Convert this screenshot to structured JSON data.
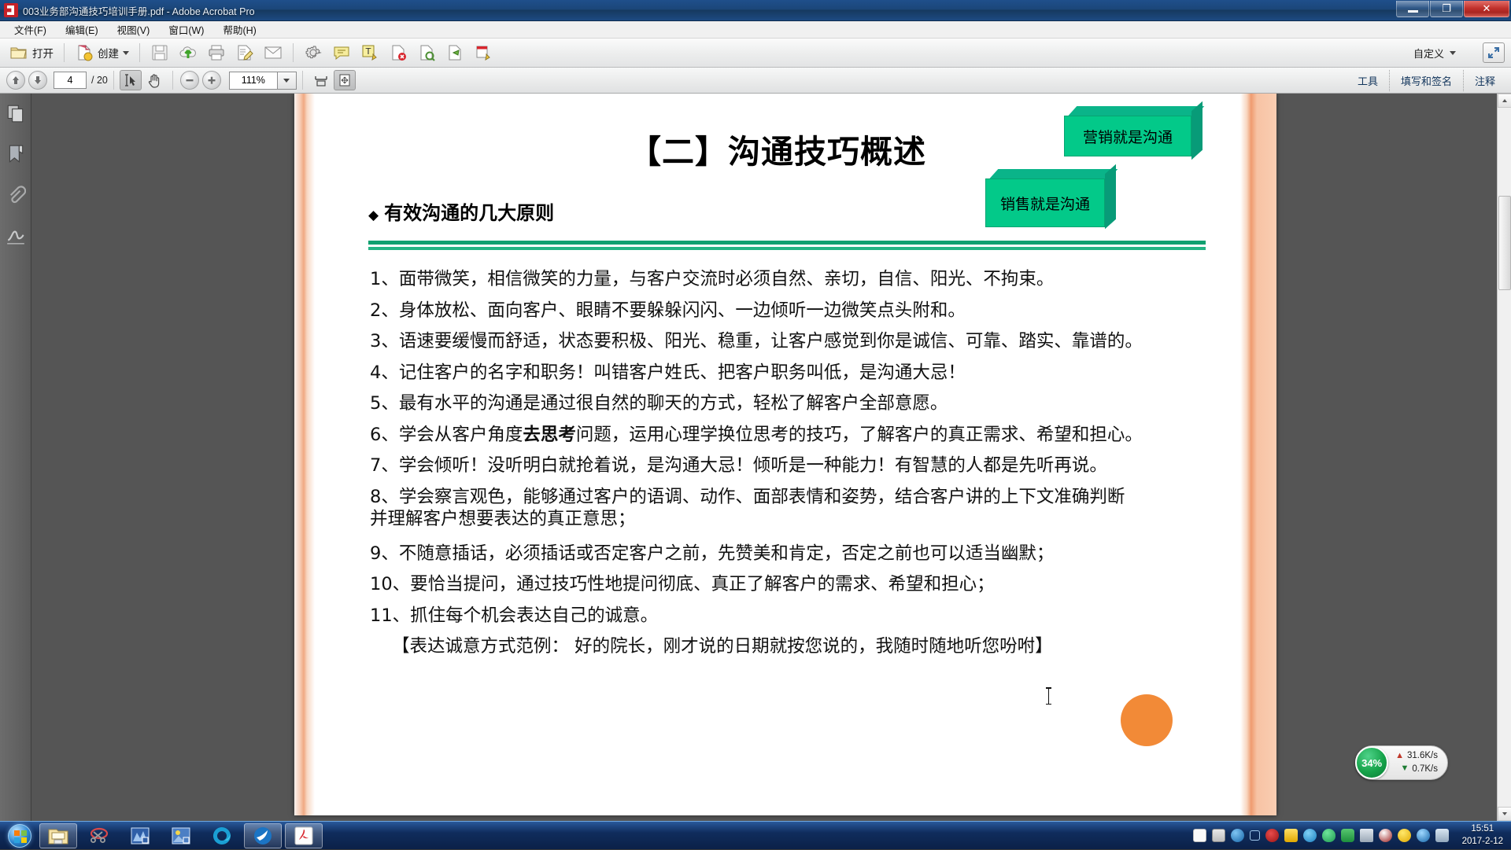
{
  "window": {
    "title": "003业务部沟通技巧培训手册.pdf - Adobe Acrobat Pro",
    "app_icon": "acrobat-icon",
    "minimize_label": "",
    "restore_label": "❐",
    "close_label": "✕"
  },
  "menubar": {
    "items": [
      {
        "label": "文件(F)",
        "name": "menu-file"
      },
      {
        "label": "编辑(E)",
        "name": "menu-edit"
      },
      {
        "label": "视图(V)",
        "name": "menu-view"
      },
      {
        "label": "窗口(W)",
        "name": "menu-window"
      },
      {
        "label": "帮助(H)",
        "name": "menu-help"
      }
    ]
  },
  "toolbar_main": {
    "open_label": "打开",
    "create_label": "创建",
    "customize_label": "自定义",
    "icons": [
      "open-folder-icon",
      "create-pdf-icon",
      "save-icon",
      "upload-cloud-icon",
      "print-icon",
      "edit-document-icon",
      "email-icon",
      "settings-gear-icon",
      "comment-bubble-icon",
      "text-edit-icon",
      "delete-page-icon",
      "redact-icon",
      "stamp-icon",
      "sign-edit-icon",
      "expand-toolbar-icon"
    ]
  },
  "toolbar_nav": {
    "page_current": "4",
    "page_total": "/ 20",
    "zoom_value": "111%",
    "icons": [
      "page-up-icon",
      "page-down-icon",
      "select-tool-icon",
      "hand-tool-icon",
      "zoom-out-icon",
      "zoom-in-icon",
      "zoom-dropdown-icon",
      "fit-width-icon",
      "fit-page-icon"
    ],
    "right_tabs": [
      {
        "label": "工具",
        "name": "tab-tools"
      },
      {
        "label": "填写和签名",
        "name": "tab-fill-sign"
      },
      {
        "label": "注释",
        "name": "tab-comment"
      }
    ]
  },
  "left_rail": {
    "items": [
      {
        "name": "page-thumbnails-icon"
      },
      {
        "name": "bookmarks-icon"
      },
      {
        "name": "attachments-icon"
      },
      {
        "name": "signatures-icon"
      }
    ]
  },
  "slide": {
    "title": "【二】沟通技巧概述",
    "bullet_marker": "◆",
    "subtitle": "有效沟通的几大原则",
    "badge_marketing": "营销就是沟通",
    "badge_sales": "销售就是沟通",
    "accent_green": "#03c989",
    "rule_green": "#10a070",
    "orange_dot": "#f28a37",
    "items": [
      "1、面带微笑，相信微笑的力量，与客户交流时必须自然、亲切，自信、阳光、不拘束。",
      "2、身体放松、面向客户、眼睛不要躲躲闪闪、一边倾听一边微笑点头附和。",
      "3、语速要缓慢而舒适，状态要积极、阳光、稳重，让客户感觉到你是诚信、可靠、踏实、靠谱的。",
      "4、记住客户的名字和职务！叫错客户姓氏、把客户职务叫低，是沟通大忌！",
      "5、最有水平的沟通是通过很自然的聊天的方式，轻松了解客户全部意愿。",
      "7、学会倾听！没听明白就抢着说，是沟通大忌！倾听是一种能力！有智慧的人都是先听再说。",
      "8、学会察言观色，能够通过客户的语调、动作、面部表情和姿势，结合客户讲的上下文准确判断",
      "并理解客户想要表达的真正意思；",
      "9、不随意插话，必须插话或否定客户之前，先赞美和肯定，否定之前也可以适当幽默；",
      "10、要恰当提问，通过技巧性地提问彻底、真正了解客户的需求、希望和担心；",
      "11、抓住每个机会表达自己的诚意。",
      "【表达诚意方式范例： 好的院长，刚才说的日期就按您说的，我随时随地听您吩咐】"
    ],
    "item6": {
      "prefix": "6、学会从客户角度",
      "bold": "去思考",
      "suffix": "问题，运用心理学换位思考的技巧，了解客户的真正需求、希望和担心。"
    }
  },
  "network_widget": {
    "percent": "34%",
    "up_rate": "31.6K/s",
    "down_rate": "0.7K/s",
    "up_icon": "arrow-up-icon",
    "down_icon": "arrow-down-icon"
  },
  "taskbar": {
    "start_name": "start-orb",
    "items": [
      {
        "name": "taskbar-explorer",
        "icon": "folder-icon"
      },
      {
        "name": "taskbar-snipping-tool",
        "icon": "scissors-icon"
      },
      {
        "name": "taskbar-app-blue",
        "icon": "chart-icon"
      },
      {
        "name": "taskbar-app-yellow",
        "icon": "image-icon"
      },
      {
        "name": "taskbar-browser",
        "icon": "circle-browser-icon"
      },
      {
        "name": "taskbar-messenger",
        "icon": "wing-icon"
      },
      {
        "name": "taskbar-acrobat",
        "icon": "acrobat-icon"
      }
    ],
    "tray_icons": [
      "notepad-tray-icon",
      "keyboard-tray-icon",
      "help-tray-icon",
      "show-hidden-icon",
      "ninja-tray-icon",
      "lock-tray-icon",
      "bird-tray-icon",
      "shield-tray-icon",
      "green-app-icon",
      "network-tray-icon",
      "qq-tray-icon",
      "plus-tray-icon",
      "volume-tray-icon",
      "input-method-icon"
    ],
    "clock_time": "15:51",
    "clock_date": "2017-2-12"
  }
}
